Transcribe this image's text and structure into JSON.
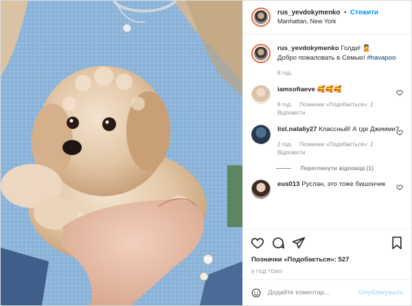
{
  "post": {
    "author": "rus_yevdokymenko",
    "follow_label": "Стежити",
    "location": "Manhattan, New York",
    "caption_text": "Голди! 🙎",
    "caption_line2": "Добро пожаловать в Семью!",
    "hashtag": "#havapoo",
    "caption_time": "8 год.",
    "likes_label": "Позначки «Подобається»: 527",
    "posted_ago": "8 ГОД ТОМУ"
  },
  "comments": [
    {
      "user": "iamsofiaeve",
      "text": "🥰🥰🥰",
      "time": "8 год.",
      "likes": "Позначки «Подобається»: 2",
      "reply": "Відповісти"
    },
    {
      "user": "list.nataliy27",
      "text": "Классный! А где Джимми?",
      "time": "2 год.",
      "likes": "Позначки «Подобається»: 2",
      "reply": "Відповісти",
      "view_replies": "Переглянути відповіді (1)"
    },
    {
      "user": "eus013",
      "text": "Руслан, это тоже бишончик"
    }
  ],
  "add_comment": {
    "placeholder": "Додайте коментар...",
    "publish_label": "Опублікувати"
  },
  "icons": {
    "like": "heart-icon",
    "comment": "comment-icon",
    "share": "share-icon",
    "save": "bookmark-icon",
    "emoji": "smiley-icon"
  },
  "colors": {
    "follow": "#0095f6",
    "meta": "#8e8e8e",
    "hashtag": "#00376b",
    "publish_disabled": "#b2dffc"
  }
}
